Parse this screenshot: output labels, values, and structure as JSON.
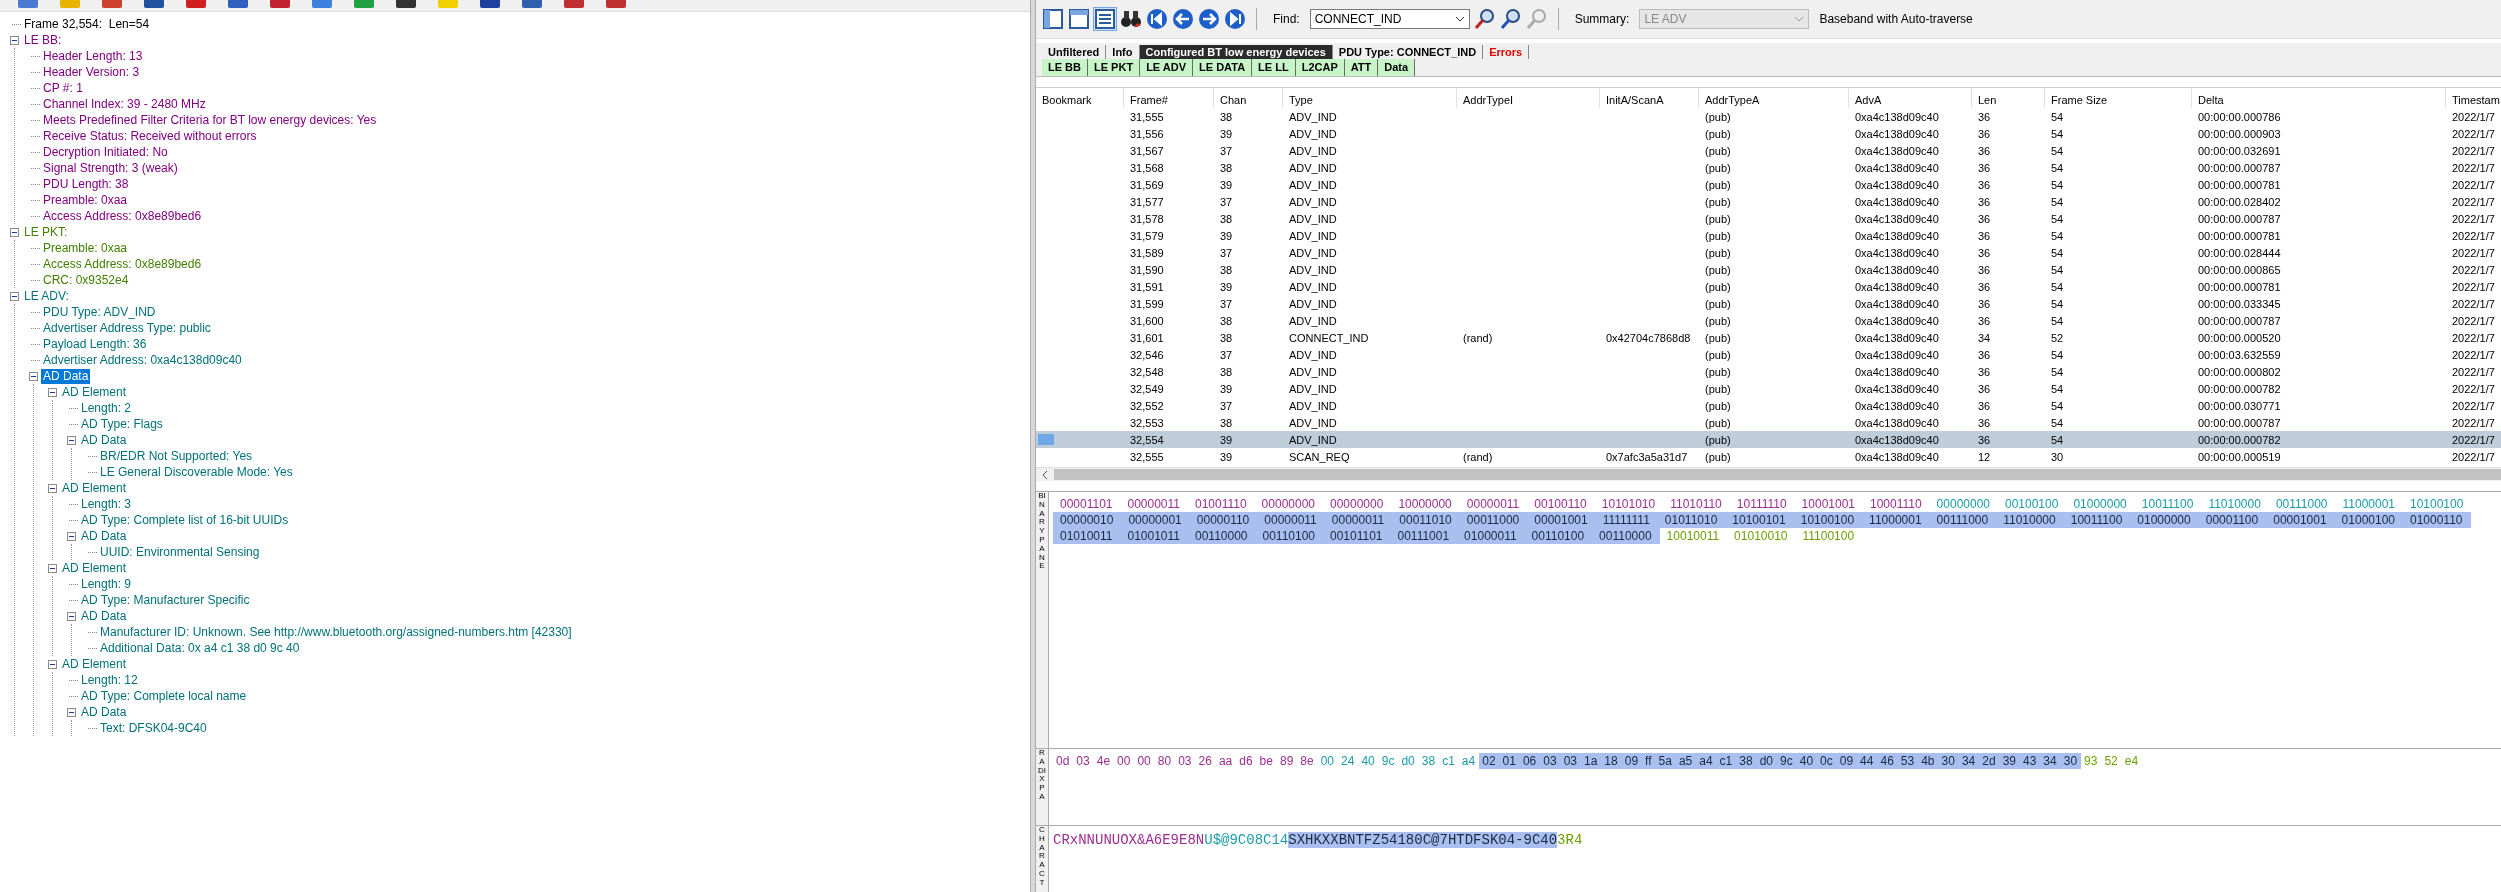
{
  "tree": [
    {
      "text": "Frame 32,554:  Len=54",
      "color": "#000000",
      "selected": false
    },
    {
      "text": "LE BB:",
      "color": "#800080",
      "expanded": true,
      "selected": false,
      "children": [
        {
          "text": "Header Length: 13",
          "selected": false
        },
        {
          "text": "Header Version: 3",
          "selected": false
        },
        {
          "text": "CP #: 1",
          "selected": false
        },
        {
          "text": "Channel Index: 39 - 2480 MHz",
          "selected": false
        },
        {
          "text": "Meets Predefined Filter Criteria for BT low energy devices: Yes",
          "selected": false
        },
        {
          "text": "Receive Status: Received without errors",
          "selected": false
        },
        {
          "text": "Decryption Initiated: No",
          "selected": false
        },
        {
          "text": "Signal Strength: 3 (weak)",
          "selected": false
        },
        {
          "text": "PDU Length: 38",
          "selected": false
        },
        {
          "text": "Preamble: 0xaa",
          "selected": false
        },
        {
          "text": "Access Address: 0x8e89bed6",
          "selected": false
        }
      ]
    },
    {
      "text": "LE PKT:",
      "color": "#3f7f00",
      "expanded": true,
      "selected": false,
      "children": [
        {
          "text": "Preamble: 0xaa",
          "selected": false
        },
        {
          "text": "Access Address: 0x8e89bed6",
          "selected": false
        },
        {
          "text": "CRC: 0x9352e4",
          "selected": false
        }
      ]
    },
    {
      "text": "LE ADV:",
      "color": "#00707a",
      "expanded": true,
      "selected": false,
      "children": [
        {
          "text": "PDU Type: ADV_IND",
          "selected": false
        },
        {
          "text": "Advertiser Address Type: public",
          "selected": false
        },
        {
          "text": "Payload Length: 36",
          "selected": false
        },
        {
          "text": "Advertiser Address: 0xa4c138d09c40",
          "selected": false
        },
        {
          "text": "AD Data",
          "expanded": true,
          "selected": true,
          "children": [
            {
              "text": "AD Element",
              "expanded": true,
              "selected": false,
              "children": [
                {
                  "text": "Length: 2",
                  "selected": false
                },
                {
                  "text": "AD Type: Flags",
                  "selected": false
                },
                {
                  "text": "AD Data",
                  "expanded": true,
                  "selected": false,
                  "children": [
                    {
                      "text": "BR/EDR Not Supported: Yes",
                      "selected": false
                    },
                    {
                      "text": "LE General Discoverable Mode: Yes",
                      "selected": false
                    }
                  ]
                }
              ]
            },
            {
              "text": "AD Element",
              "expanded": true,
              "selected": false,
              "children": [
                {
                  "text": "Length: 3",
                  "selected": false
                },
                {
                  "text": "AD Type: Complete list of 16-bit UUIDs",
                  "selected": false
                },
                {
                  "text": "AD Data",
                  "expanded": true,
                  "selected": false,
                  "children": [
                    {
                      "text": "UUID: Environmental Sensing",
                      "selected": false
                    }
                  ]
                }
              ]
            },
            {
              "text": "AD Element",
              "expanded": true,
              "selected": false,
              "children": [
                {
                  "text": "Length: 9",
                  "selected": false
                },
                {
                  "text": "AD Type: Manufacturer Specific",
                  "selected": false
                },
                {
                  "text": "AD Data",
                  "expanded": true,
                  "selected": false,
                  "children": [
                    {
                      "text": "Manufacturer ID: Unknown. See http://www.bluetooth.org/assigned-numbers.htm [42330]",
                      "selected": false
                    },
                    {
                      "text": "Additional Data: 0x a4 c1 38 d0 9c 40",
                      "selected": false
                    }
                  ]
                }
              ]
            },
            {
              "text": "AD Element",
              "expanded": true,
              "selected": false,
              "children": [
                {
                  "text": "Length: 12",
                  "selected": false
                },
                {
                  "text": "AD Type: Complete local name",
                  "selected": false
                },
                {
                  "text": "AD Data",
                  "expanded": true,
                  "selected": false,
                  "children": [
                    {
                      "text": "Text: DFSK04-9C40",
                      "selected": false
                    }
                  ]
                }
              ]
            }
          ]
        }
      ]
    }
  ],
  "toolbar": {
    "find_label": "Find:",
    "find_value": "CONNECT_IND",
    "summary_label": "Summary:",
    "summary": {
      "value": "LE ADV",
      "disabled": true
    },
    "summary_note": "Baseband with Auto-traverse"
  },
  "filter_tabs": [
    {
      "label": "Unfiltered",
      "kind": "normal",
      "selected": false
    },
    {
      "label": "Info",
      "kind": "normal",
      "selected": false
    },
    {
      "label": "Configured BT low energy devices",
      "kind": "normal",
      "selected": true
    },
    {
      "label": "PDU Type: CONNECT_IND",
      "kind": "normal",
      "selected": false
    },
    {
      "label": "Errors",
      "kind": "error",
      "selected": false
    }
  ],
  "layer_tabs": [
    {
      "label": "LE BB",
      "selected": false
    },
    {
      "label": "LE PKT",
      "selected": false
    },
    {
      "label": "LE ADV",
      "selected": false
    },
    {
      "label": "LE DATA",
      "selected": false
    },
    {
      "label": "LE LL",
      "selected": false
    },
    {
      "label": "L2CAP",
      "selected": false
    },
    {
      "label": "ATT",
      "selected": false
    },
    {
      "label": "Data",
      "selected": false
    }
  ],
  "table": {
    "columns": [
      "Bookmark",
      "Frame#",
      "Chan",
      "Type",
      "AddrTypeI",
      "InitA/ScanA",
      "AddrTypeA",
      "AdvA",
      "Len",
      "Frame Size",
      "Delta",
      "Timestam"
    ],
    "rows": [
      {
        "frame": "31,555",
        "chan": "38",
        "type": "ADV_IND",
        "addr_type_a": "(pub)",
        "adv_a": "0xa4c138d09c40",
        "len": "36",
        "frame_size": "54",
        "delta": "00:00:00.000786",
        "timestamp": "2022/1/7",
        "selected": false
      },
      {
        "frame": "31,556",
        "chan": "39",
        "type": "ADV_IND",
        "addr_type_a": "(pub)",
        "adv_a": "0xa4c138d09c40",
        "len": "36",
        "frame_size": "54",
        "delta": "00:00:00.000903",
        "timestamp": "2022/1/7",
        "selected": false
      },
      {
        "frame": "31,567",
        "chan": "37",
        "type": "ADV_IND",
        "addr_type_a": "(pub)",
        "adv_a": "0xa4c138d09c40",
        "len": "36",
        "frame_size": "54",
        "delta": "00:00:00.032691",
        "timestamp": "2022/1/7",
        "selected": false
      },
      {
        "frame": "31,568",
        "chan": "38",
        "type": "ADV_IND",
        "addr_type_a": "(pub)",
        "adv_a": "0xa4c138d09c40",
        "len": "36",
        "frame_size": "54",
        "delta": "00:00:00.000787",
        "timestamp": "2022/1/7",
        "selected": false
      },
      {
        "frame": "31,569",
        "chan": "39",
        "type": "ADV_IND",
        "addr_type_a": "(pub)",
        "adv_a": "0xa4c138d09c40",
        "len": "36",
        "frame_size": "54",
        "delta": "00:00:00.000781",
        "timestamp": "2022/1/7",
        "selected": false
      },
      {
        "frame": "31,577",
        "chan": "37",
        "type": "ADV_IND",
        "addr_type_a": "(pub)",
        "adv_a": "0xa4c138d09c40",
        "len": "36",
        "frame_size": "54",
        "delta": "00:00:00.028402",
        "timestamp": "2022/1/7",
        "selected": false
      },
      {
        "frame": "31,578",
        "chan": "38",
        "type": "ADV_IND",
        "addr_type_a": "(pub)",
        "adv_a": "0xa4c138d09c40",
        "len": "36",
        "frame_size": "54",
        "delta": "00:00:00.000787",
        "timestamp": "2022/1/7",
        "selected": false
      },
      {
        "frame": "31,579",
        "chan": "39",
        "type": "ADV_IND",
        "addr_type_a": "(pub)",
        "adv_a": "0xa4c138d09c40",
        "len": "36",
        "frame_size": "54",
        "delta": "00:00:00.000781",
        "timestamp": "2022/1/7",
        "selected": false
      },
      {
        "frame": "31,589",
        "chan": "37",
        "type": "ADV_IND",
        "addr_type_a": "(pub)",
        "adv_a": "0xa4c138d09c40",
        "len": "36",
        "frame_size": "54",
        "delta": "00:00:00.028444",
        "timestamp": "2022/1/7",
        "selected": false
      },
      {
        "frame": "31,590",
        "chan": "38",
        "type": "ADV_IND",
        "addr_type_a": "(pub)",
        "adv_a": "0xa4c138d09c40",
        "len": "36",
        "frame_size": "54",
        "delta": "00:00:00.000865",
        "timestamp": "2022/1/7",
        "selected": false
      },
      {
        "frame": "31,591",
        "chan": "39",
        "type": "ADV_IND",
        "addr_type_a": "(pub)",
        "adv_a": "0xa4c138d09c40",
        "len": "36",
        "frame_size": "54",
        "delta": "00:00:00.000781",
        "timestamp": "2022/1/7",
        "selected": false
      },
      {
        "frame": "31,599",
        "chan": "37",
        "type": "ADV_IND",
        "addr_type_a": "(pub)",
        "adv_a": "0xa4c138d09c40",
        "len": "36",
        "frame_size": "54",
        "delta": "00:00:00.033345",
        "timestamp": "2022/1/7",
        "selected": false
      },
      {
        "frame": "31,600",
        "chan": "38",
        "type": "ADV_IND",
        "addr_type_a": "(pub)",
        "adv_a": "0xa4c138d09c40",
        "len": "36",
        "frame_size": "54",
        "delta": "00:00:00.000787",
        "timestamp": "2022/1/7",
        "selected": false
      },
      {
        "frame": "31,601",
        "chan": "38",
        "type": "CONNECT_IND",
        "addr_type_i": "(rand)",
        "init_a": "0x42704c7868d8",
        "addr_type_a": "(pub)",
        "adv_a": "0xa4c138d09c40",
        "len": "34",
        "frame_size": "52",
        "delta": "00:00:00.000520",
        "timestamp": "2022/1/7",
        "selected": false
      },
      {
        "frame": "32,546",
        "chan": "37",
        "type": "ADV_IND",
        "addr_type_a": "(pub)",
        "adv_a": "0xa4c138d09c40",
        "len": "36",
        "frame_size": "54",
        "delta": "00:00:03.632559",
        "timestamp": "2022/1/7",
        "selected": false
      },
      {
        "frame": "32,548",
        "chan": "38",
        "type": "ADV_IND",
        "addr_type_a": "(pub)",
        "adv_a": "0xa4c138d09c40",
        "len": "36",
        "frame_size": "54",
        "delta": "00:00:00.000802",
        "timestamp": "2022/1/7",
        "selected": false
      },
      {
        "frame": "32,549",
        "chan": "39",
        "type": "ADV_IND",
        "addr_type_a": "(pub)",
        "adv_a": "0xa4c138d09c40",
        "len": "36",
        "frame_size": "54",
        "delta": "00:00:00.000782",
        "timestamp": "2022/1/7",
        "selected": false
      },
      {
        "frame": "32,552",
        "chan": "37",
        "type": "ADV_IND",
        "addr_type_a": "(pub)",
        "adv_a": "0xa4c138d09c40",
        "len": "36",
        "frame_size": "54",
        "delta": "00:00:00.030771",
        "timestamp": "2022/1/7",
        "selected": false
      },
      {
        "frame": "32,553",
        "chan": "38",
        "type": "ADV_IND",
        "addr_type_a": "(pub)",
        "adv_a": "0xa4c138d09c40",
        "len": "36",
        "frame_size": "54",
        "delta": "00:00:00.000787",
        "timestamp": "2022/1/7",
        "selected": false
      },
      {
        "frame": "32,554",
        "chan": "39",
        "type": "ADV_IND",
        "addr_type_a": "(pub)",
        "adv_a": "0xa4c138d09c40",
        "len": "36",
        "frame_size": "54",
        "delta": "00:00:00.000782",
        "timestamp": "2022/1/7",
        "selected": true
      },
      {
        "frame": "32,555",
        "chan": "39",
        "type": "SCAN_REQ",
        "addr_type_i": "(rand)",
        "init_a": "0x7afc3a5a31d7",
        "addr_type_a": "(pub)",
        "adv_a": "0xa4c138d09c40",
        "len": "12",
        "frame_size": "30",
        "delta": "00:00:00.000519",
        "timestamp": "2022/1/7",
        "selected": false
      }
    ]
  },
  "binary_pane_label": "BINARY PANE",
  "radix_pane_label": "RADIX PA",
  "character_pane_label": "CHARACT",
  "segments": [
    {
      "kind": "header",
      "highlighted": false,
      "hex": [
        "0d",
        "03",
        "4e",
        "00",
        "00",
        "80",
        "03",
        "26",
        "aa",
        "d6",
        "be",
        "89",
        "8e"
      ],
      "binary": [
        "00001101",
        "00000011",
        "01001110",
        "00000000",
        "00000000",
        "10000000",
        "00000011",
        "00100110",
        "10101010",
        "11010110",
        "10111110",
        "10001001",
        "10001110"
      ],
      "chars": "CRxNNUNUOX&A6E9E8N"
    },
    {
      "kind": "address",
      "highlighted": false,
      "hex": [
        "00",
        "24",
        "40",
        "9c",
        "d0",
        "38",
        "c1",
        "a4"
      ],
      "binary": [
        "00000000",
        "00100100",
        "01000000",
        "10011100",
        "11010000",
        "00111000",
        "11000001",
        "10100100"
      ],
      "chars": "U$@9C08C14"
    },
    {
      "kind": "payload",
      "highlighted": true,
      "hex": [
        "02",
        "01",
        "06",
        "03",
        "03",
        "1a",
        "18",
        "09",
        "ff",
        "5a",
        "a5",
        "a4",
        "c1",
        "38",
        "d0",
        "9c",
        "40",
        "0c",
        "09",
        "44",
        "46",
        "53",
        "4b",
        "30",
        "34",
        "2d",
        "39",
        "43",
        "34",
        "30"
      ],
      "binary": [
        "00000010",
        "00000001",
        "00000110",
        "00000011",
        "00000011",
        "00011010",
        "00011000",
        "00001001",
        "11111111",
        "01011010",
        "10100101",
        "10100100",
        "11000001",
        "00111000",
        "11010000",
        "10011100",
        "01000000",
        "00001100",
        "00001001",
        "01000100",
        "01000110",
        "01010011",
        "01001011",
        "00110000",
        "00110100",
        "00101101",
        "00111001",
        "01000011",
        "00110100",
        "00110000"
      ],
      "chars": "SXHKXXBNTFZ54180C@7HTDFSK04-9C40"
    },
    {
      "kind": "crc",
      "highlighted": false,
      "hex": [
        "93",
        "52",
        "e4"
      ],
      "binary": [
        "10010011",
        "01010010",
        "11100100"
      ],
      "chars": "3R4"
    }
  ]
}
